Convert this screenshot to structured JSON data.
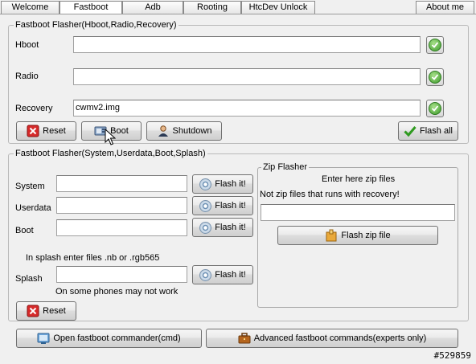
{
  "tabs": [
    "Welcome",
    "Fastboot",
    "Adb",
    "Rooting",
    "HtcDev Unlock",
    "About me"
  ],
  "group1": {
    "title": "Fastboot Flasher(Hboot,Radio,Recovery)",
    "hboot_label": "Hboot",
    "hboot_value": "",
    "radio_label": "Radio",
    "radio_value": "",
    "recovery_label": "Recovery",
    "recovery_value": "cwmv2.img",
    "reset_label": "Reset",
    "boot_label": "Boot",
    "shutdown_label": "Shutdown",
    "flash_all_label": "Flash all"
  },
  "group2": {
    "title": "Fastboot Flasher(System,Userdata,Boot,Splash)",
    "system_label": "System",
    "system_value": "",
    "userdata_label": "Userdata",
    "userdata_value": "",
    "boot_label": "Boot",
    "boot_value": "",
    "flash_it_label": "Flash it!",
    "splash_hint": "In splash enter files .nb or .rgb565",
    "splash_label": "Splash",
    "splash_value": "",
    "splash_note": "On some phones may not work",
    "reset_label": "Reset"
  },
  "zip": {
    "title": "Zip Flasher",
    "hint1": "Enter here zip files",
    "hint2": "Not zip files that runs with recovery!",
    "zip_value": "",
    "flash_zip_label": "Flash zip file"
  },
  "bottom": {
    "cmd_label": "Open fastboot commander(cmd)",
    "advanced_label": "Advanced fastboot commands(experts only)"
  },
  "watermark": "#529859",
  "icons": {
    "ok": "check-circle-icon",
    "reset": "red-x-icon",
    "boot": "device-icon",
    "shutdown": "person-icon",
    "flash_all": "green-check-icon",
    "flash_it": "disc-icon",
    "flash_zip": "package-icon",
    "cmd": "terminal-icon",
    "advanced": "briefcase-icon"
  }
}
